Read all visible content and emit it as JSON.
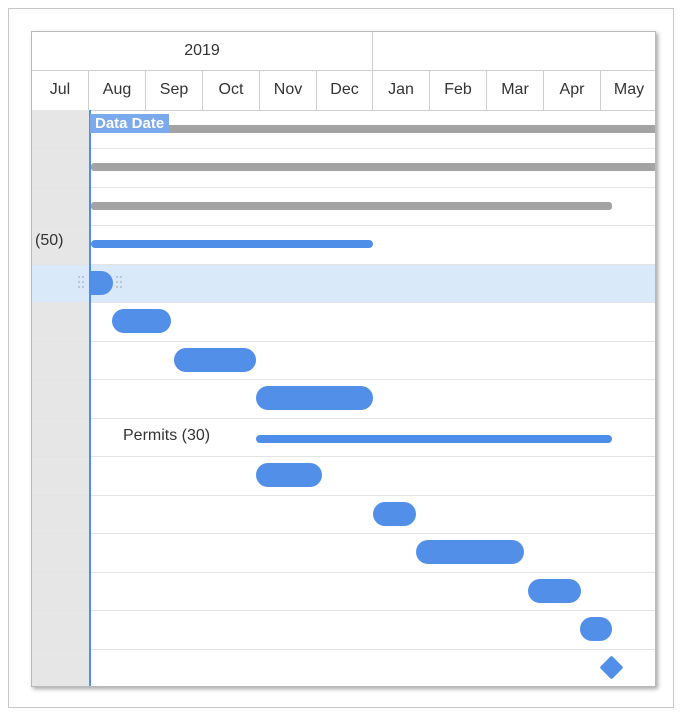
{
  "timeline": {
    "year": "2019",
    "months": [
      "Jul",
      "Aug",
      "Sep",
      "Oct",
      "Nov",
      "Dec",
      "Jan",
      "Feb",
      "Mar",
      "Apr",
      "May"
    ]
  },
  "data_date": {
    "label": "Data Date"
  },
  "labels": {
    "summary_duration": "(50)",
    "permits": "Permits (30)"
  },
  "colors": {
    "task_bar": "#528fe8",
    "summary_bar": "#a3a3a3",
    "selected_row": "#d9e9f9",
    "past_shade": "#e6e6e6",
    "data_date_label": "#7aa9ee"
  }
}
